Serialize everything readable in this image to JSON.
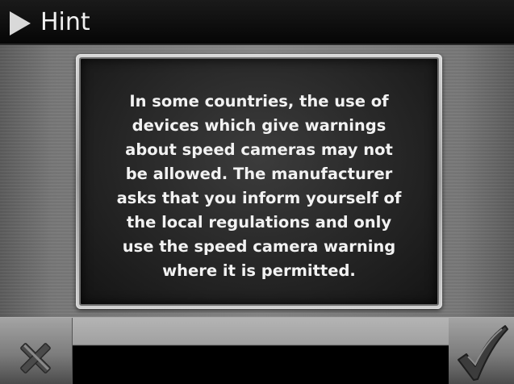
{
  "header": {
    "title": "Hint",
    "icon": "play-arrow-icon"
  },
  "message": {
    "text": "In some countries, the use of\ndevices which give warnings\nabout speed cameras may not\nbe allowed. The manufacturer\nasks that you inform yourself of\nthe local regulations and only\nuse the speed camera warning\nwhere it is permitted."
  },
  "footer": {
    "cancel_icon": "close-x-icon",
    "confirm_icon": "checkmark-icon"
  }
}
